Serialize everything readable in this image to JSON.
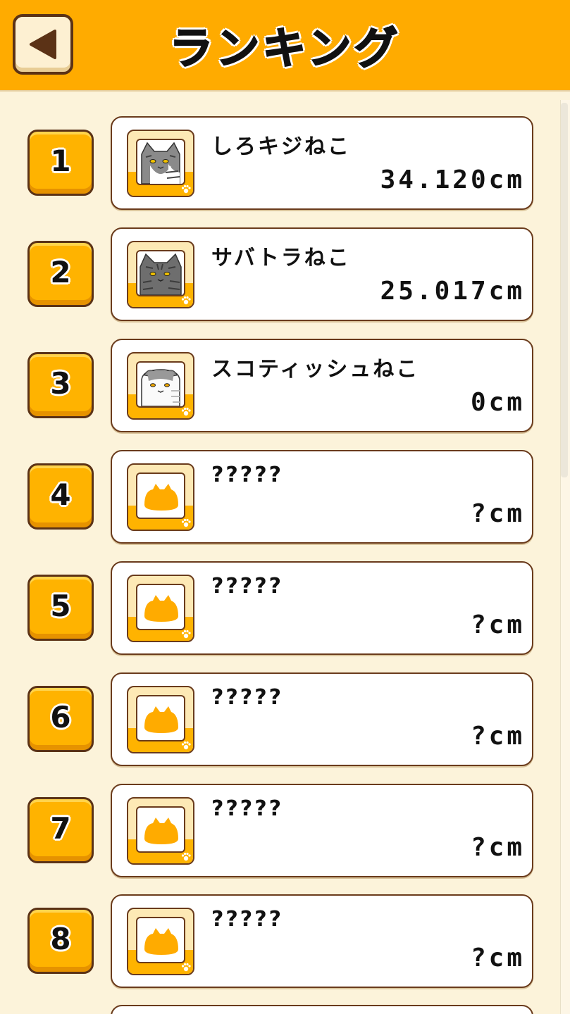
{
  "header": {
    "title": "ランキング"
  },
  "ranking": [
    {
      "rank": "1",
      "name": "しろキジねこ",
      "distance": "34.120cm",
      "icon": "cat-silver-tabby"
    },
    {
      "rank": "2",
      "name": "サバトラねこ",
      "distance": "25.017cm",
      "icon": "cat-gray-tabby"
    },
    {
      "rank": "3",
      "name": "スコティッシュねこ",
      "distance": "0cm",
      "icon": "cat-scottish-fold"
    },
    {
      "rank": "4",
      "name": "?????",
      "distance": "?cm",
      "icon": "cat-silhouette"
    },
    {
      "rank": "5",
      "name": "?????",
      "distance": "?cm",
      "icon": "cat-silhouette"
    },
    {
      "rank": "6",
      "name": "?????",
      "distance": "?cm",
      "icon": "cat-silhouette"
    },
    {
      "rank": "7",
      "name": "?????",
      "distance": "?cm",
      "icon": "cat-silhouette"
    },
    {
      "rank": "8",
      "name": "?????",
      "distance": "?cm",
      "icon": "cat-silhouette"
    }
  ],
  "colors": {
    "header": "#ffab00",
    "background": "#fcf3da",
    "badge": "#ffb300",
    "border": "#5b3216"
  }
}
